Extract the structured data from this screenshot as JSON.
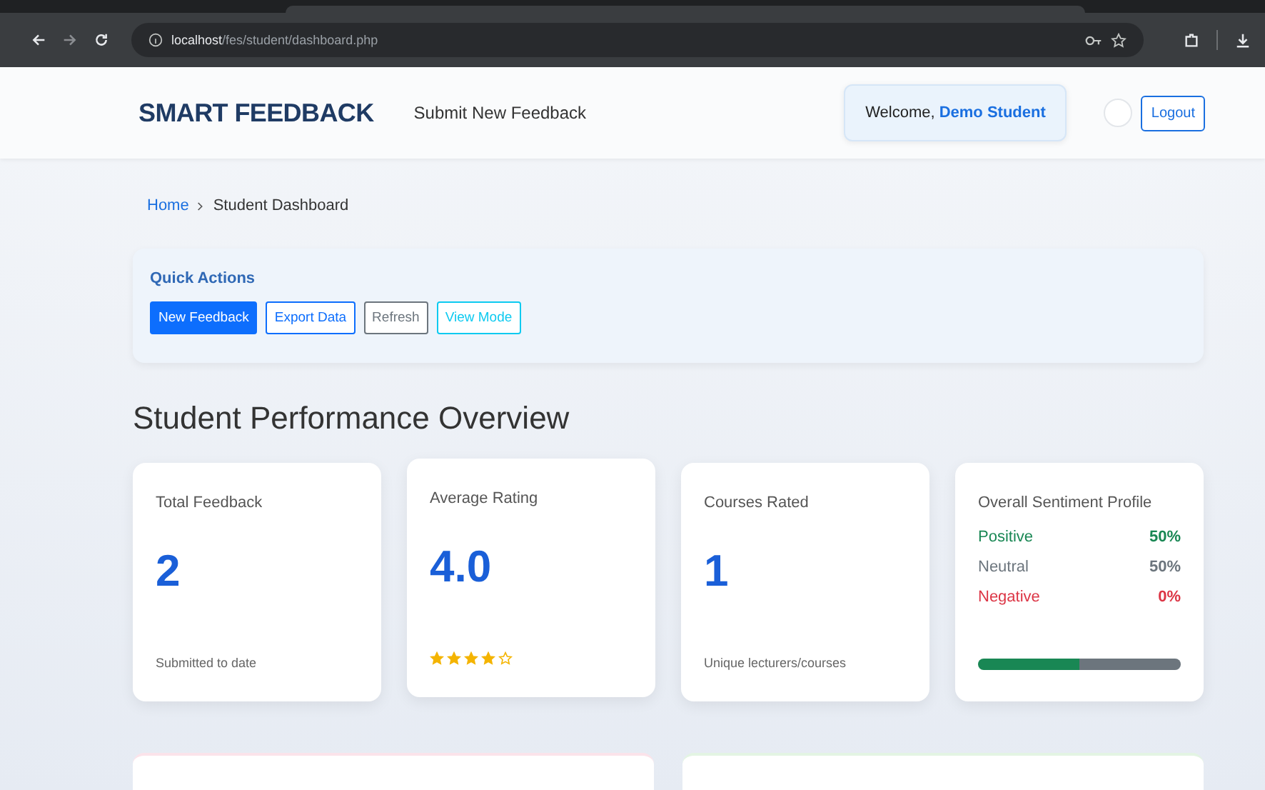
{
  "browser": {
    "url_host": "localhost",
    "url_path": "/fes/student/dashboard.php"
  },
  "navbar": {
    "brand": "SMART FEEDBACK",
    "links": [
      "Submit New Feedback"
    ],
    "welcome_label": "Welcome,",
    "user_name": "Demo Student",
    "dark_mode": false,
    "logout": "Logout"
  },
  "breadcrumb": [
    {
      "label": "Home",
      "link": true
    },
    {
      "label": "Student Dashboard",
      "link": false
    }
  ],
  "quick_actions": {
    "title": "Quick Actions",
    "buttons": [
      {
        "label": "New Feedback",
        "kind": "solid",
        "color": "#0d6efd"
      },
      {
        "label": "Export Data",
        "kind": "outline",
        "color": "#0d6efd"
      },
      {
        "label": "Refresh",
        "kind": "outline",
        "color": "#6c757d"
      },
      {
        "label": "View Mode",
        "kind": "outline",
        "color": "#0dcaf0"
      }
    ]
  },
  "section_title": "Student Performance Overview",
  "cards": [
    {
      "kind": "number",
      "title": "Total Feedback",
      "value": "2",
      "caption": "Submitted to date"
    },
    {
      "kind": "rating",
      "title": "Average Rating",
      "value": "4.0",
      "stars": 4
    },
    {
      "kind": "number",
      "title": "Courses Rated",
      "value": "1",
      "caption": "Unique lecturers/courses"
    },
    {
      "kind": "sentiment",
      "title": "Overall Sentiment Profile",
      "rows": [
        {
          "label": "Positive",
          "value": "50%",
          "color": "#198754",
          "level": 0.5
        },
        {
          "label": "Neutral",
          "value": "50%",
          "color": "#6c757d",
          "level": 0.5
        },
        {
          "label": "Negative",
          "value": "0%",
          "color": "#dc3545"
        }
      ]
    }
  ]
}
